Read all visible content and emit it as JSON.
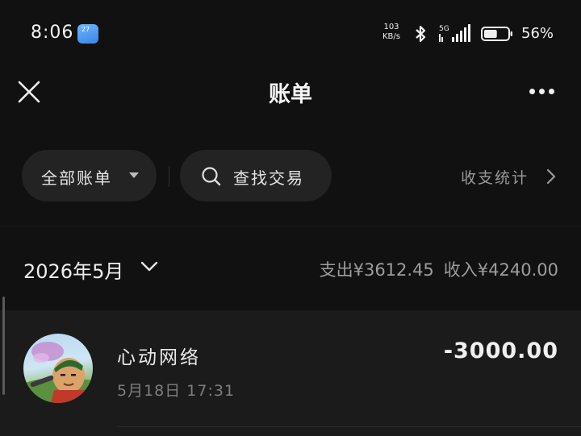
{
  "status_bar": {
    "time": "8:06",
    "weather_badge": "27",
    "net_speed_value": "103",
    "net_speed_unit": "KB/s",
    "signal_label": "5G",
    "battery_percent": 56,
    "battery_text": "56%"
  },
  "header": {
    "title": "账单",
    "close_icon": "close-icon",
    "more_icon": "more-horizontal-icon"
  },
  "filters": {
    "all_bills_label": "全部账单",
    "search_label": "查找交易",
    "stats_label": "收支统计"
  },
  "month_section": {
    "month_label": "2026年5月",
    "expense_text": "支出¥3612.45",
    "income_text": "收入¥4240.00"
  },
  "transactions": [
    {
      "name": "心动网络",
      "time": "5月18日 17:31",
      "amount": "-3000.00"
    }
  ]
}
